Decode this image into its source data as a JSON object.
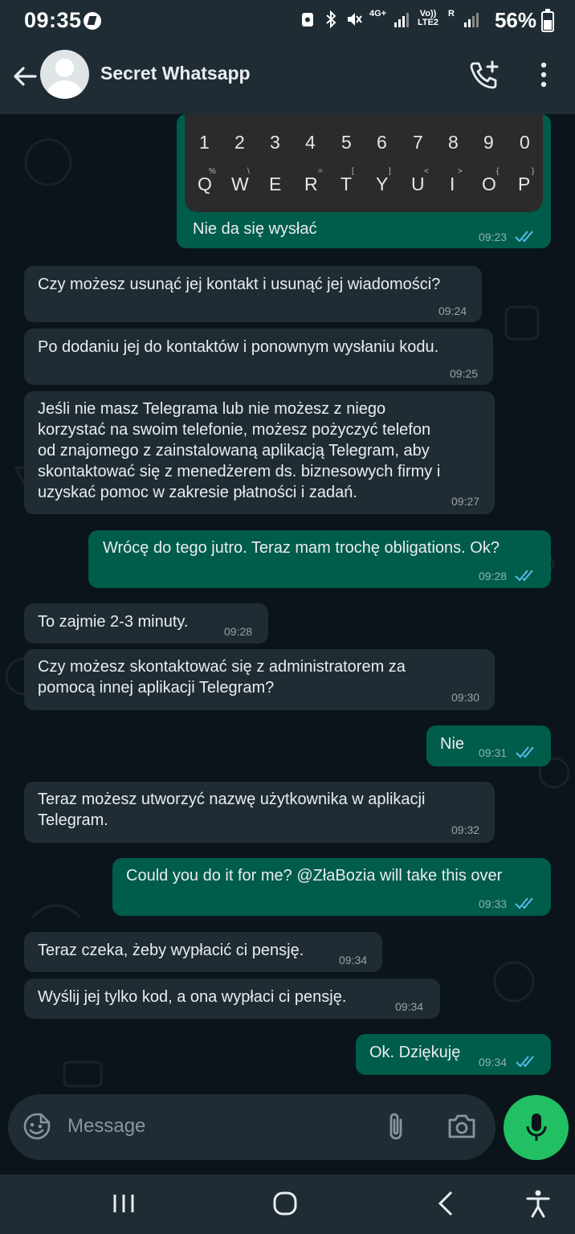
{
  "status_bar": {
    "time": "09:35",
    "network_4g": "4G+",
    "volte": "Vo)) LTE2",
    "roaming": "R",
    "battery_percent": "56%"
  },
  "header": {
    "contact_name": "Secret Whatsapp",
    "back_icon": "arrow-left",
    "call_icon": "add-call",
    "menu_icon": "more-vertical"
  },
  "keyboard_image": {
    "numbers": [
      "1",
      "2",
      "3",
      "4",
      "5",
      "6",
      "7",
      "8",
      "9",
      "0"
    ],
    "letters": [
      "Q",
      "W",
      "E",
      "R",
      "T",
      "Y",
      "U",
      "I",
      "O",
      "P"
    ],
    "sub_symbols": [
      "%",
      "\\",
      "=",
      "[",
      "]",
      "<",
      ">",
      "{",
      "}"
    ]
  },
  "messages": [
    {
      "direction": "out",
      "text": "Nie da się wysłać",
      "time": "09:23"
    },
    {
      "direction": "in",
      "text": "Czy możesz usunąć jej kontakt i usunąć jej wiadomości?",
      "time": "09:24"
    },
    {
      "direction": "in",
      "text": "Po dodaniu jej do kontaktów i ponownym wysłaniu kodu.",
      "time": "09:25"
    },
    {
      "direction": "in",
      "lines": [
        "Jeśli nie masz Telegrama lub nie możesz z niego",
        "korzystać na swoim telefonie, możesz pożyczyć telefon",
        "od znajomego z zainstalowaną aplikacją Telegram, aby",
        "skontaktować się z menedżerem ds. biznesowych firmy i",
        "uzyskać pomoc w zakresie płatności i zadań."
      ],
      "time": "09:27"
    },
    {
      "direction": "out",
      "text": "Wrócę do tego jutro. Teraz mam trochę obligations. Ok?",
      "time": "09:28"
    },
    {
      "direction": "in",
      "text": "To zajmie 2-3 minuty.",
      "time": "09:28"
    },
    {
      "direction": "in",
      "lines": [
        "Czy możesz skontaktować się z administratorem za",
        "pomocą innej aplikacji Telegram?"
      ],
      "time": "09:30"
    },
    {
      "direction": "out",
      "text": "Nie",
      "time": "09:31"
    },
    {
      "direction": "in",
      "lines": [
        "Teraz możesz utworzyć nazwę użytkownika w aplikacji",
        "Telegram."
      ],
      "time": "09:32"
    },
    {
      "direction": "out",
      "text": "Could you do it for me? @ZłaBozia will take this over",
      "time": "09:33"
    },
    {
      "direction": "in",
      "text": "Teraz czeka, żeby wypłacić ci pensję.",
      "time": "09:34"
    },
    {
      "direction": "in",
      "text": "Wyślij jej tylko kod, a ona wypłaci ci pensję.",
      "time": "09:34"
    },
    {
      "direction": "out",
      "text": "Ok. Dziękuję",
      "time": "09:34"
    }
  ],
  "composer": {
    "placeholder": "Message",
    "emoji_icon": "emoji",
    "attach_icon": "paperclip",
    "camera_icon": "camera",
    "mic_icon": "microphone"
  },
  "colors": {
    "background": "#0b141a",
    "incoming": "#202c33",
    "outgoing": "#005c4b",
    "bar": "#1f2c34",
    "mic": "#21c063",
    "read_ticks": "#53bdeb"
  }
}
